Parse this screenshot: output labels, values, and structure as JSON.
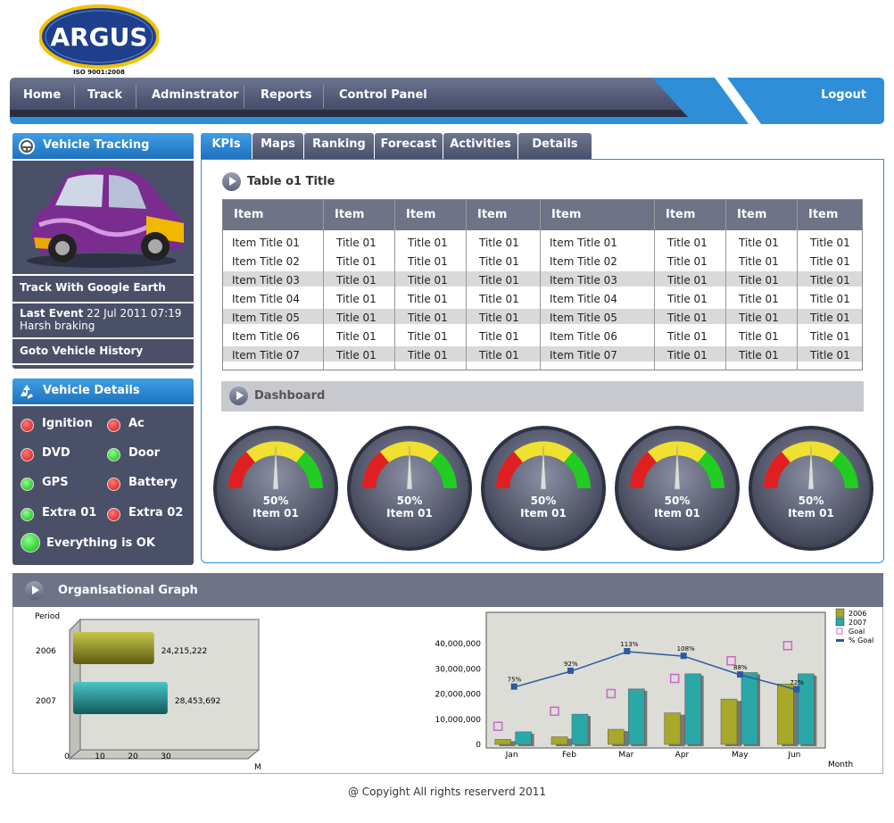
{
  "logo": {
    "brand": "ARGUS",
    "cert": "ISO 9001:2008"
  },
  "nav": {
    "items": [
      "Home",
      "Track",
      "Adminstrator",
      "Reports",
      "Control Panel"
    ],
    "logout": "Logout"
  },
  "vehicle_tracking": {
    "title": "Vehicle Tracking",
    "google_earth": "Track With Google Earth",
    "last_event_label": "Last Event",
    "last_event_time": "22 Jul 2011 07:19",
    "last_event_desc": "Harsh braking",
    "history": "Goto Vehicle History"
  },
  "vehicle_details": {
    "title": "Vehicle Details",
    "items": [
      {
        "label": "Ignition",
        "status": "red"
      },
      {
        "label": "Ac",
        "status": "red"
      },
      {
        "label": "DVD",
        "status": "red"
      },
      {
        "label": "Door",
        "status": "green"
      },
      {
        "label": "GPS",
        "status": "green"
      },
      {
        "label": "Battery",
        "status": "red"
      },
      {
        "label": "Extra 01",
        "status": "green"
      },
      {
        "label": "Extra 02",
        "status": "red"
      }
    ],
    "overall": "Everything is OK"
  },
  "tabs": [
    "KPIs",
    "Maps",
    "Ranking",
    "Forecast",
    "Activities",
    "Details"
  ],
  "table": {
    "title": "Table o1 Title",
    "headers": [
      "Item",
      "Item",
      "Item",
      "Item",
      "Item",
      "Item",
      "Item",
      "Item"
    ],
    "rows": [
      [
        "Item Title 01",
        "Title 01",
        "Title 01",
        "Title 01",
        "Item Title 01",
        "Title 01",
        "Title 01",
        "Title 01"
      ],
      [
        "Item Title 02",
        "Title 01",
        "Title 01",
        "Title 01",
        "Item Title 02",
        "Title 01",
        "Title 01",
        "Title 01"
      ],
      [
        "Item Title 03",
        "Title 01",
        "Title 01",
        "Title 01",
        "Item Title 03",
        "Title 01",
        "Title 01",
        "Title 01"
      ],
      [
        "Item Title 04",
        "Title 01",
        "Title 01",
        "Title 01",
        "Item Title 04",
        "Title 01",
        "Title 01",
        "Title 01"
      ],
      [
        "Item Title 05",
        "Title 01",
        "Title 01",
        "Title 01",
        "Item Title 05",
        "Title 01",
        "Title 01",
        "Title 01"
      ],
      [
        "Item Title 06",
        "Title 01",
        "Title 01",
        "Title 01",
        "Item Title 06",
        "Title 01",
        "Title 01",
        "Title 01"
      ],
      [
        "Item Title 07",
        "Title 01",
        "Title 01",
        "Title 01",
        "Item Title 07",
        "Title 01",
        "Title 01",
        "Title 01"
      ]
    ]
  },
  "dashboard": {
    "title": "Dashboard",
    "gauges": [
      {
        "value": "50%",
        "label": "Item 01"
      },
      {
        "value": "50%",
        "label": "Item 01"
      },
      {
        "value": "50%",
        "label": "Item 01"
      },
      {
        "value": "50%",
        "label": "Item 01"
      },
      {
        "value": "50%",
        "label": "Item 01"
      }
    ]
  },
  "org_graph": {
    "title": "Organisational Graph"
  },
  "chart_data": [
    {
      "type": "bar",
      "orientation": "horizontal",
      "categories": [
        "2006",
        "2007"
      ],
      "values": [
        24215222,
        28453692
      ],
      "value_labels": [
        "24,215,222",
        "28,453,692"
      ],
      "ylabel": "Period",
      "xlabel": "M",
      "xticks": [
        "0",
        "10",
        "20",
        "30"
      ],
      "xlim": [
        0,
        30
      ]
    },
    {
      "type": "bar",
      "categories": [
        "Jan",
        "Feb",
        "Mar",
        "Apr",
        "May",
        "Jun"
      ],
      "series": [
        {
          "name": "2006",
          "values": [
            2000000,
            3000000,
            6000000,
            12500000,
            18000000,
            24000000
          ],
          "color": "#a8a82a"
        },
        {
          "name": "2007",
          "values": [
            5000000,
            12000000,
            22000000,
            28000000,
            28500000,
            28000000
          ],
          "color": "#2aa8a8"
        },
        {
          "name": "Goal",
          "type": "marker",
          "values": [
            7000000,
            13000000,
            20000000,
            26000000,
            33000000,
            39000000
          ],
          "color": "#cc66cc"
        },
        {
          "name": "% Goal",
          "type": "line",
          "values": [
            75,
            92,
            113,
            108,
            88,
            72
          ],
          "labels": [
            "75%",
            "92%",
            "113%",
            "108%",
            "88%",
            "72%"
          ],
          "color": "#2a5aa0"
        }
      ],
      "xlabel": "Month",
      "yticks": [
        "0",
        "10,000,000",
        "20,000,000",
        "30,000,000",
        "40,000,000"
      ],
      "ylim": [
        0,
        40000000
      ],
      "legend": "right"
    }
  ],
  "footer": "@ Copyight All rights reserverd 2011"
}
